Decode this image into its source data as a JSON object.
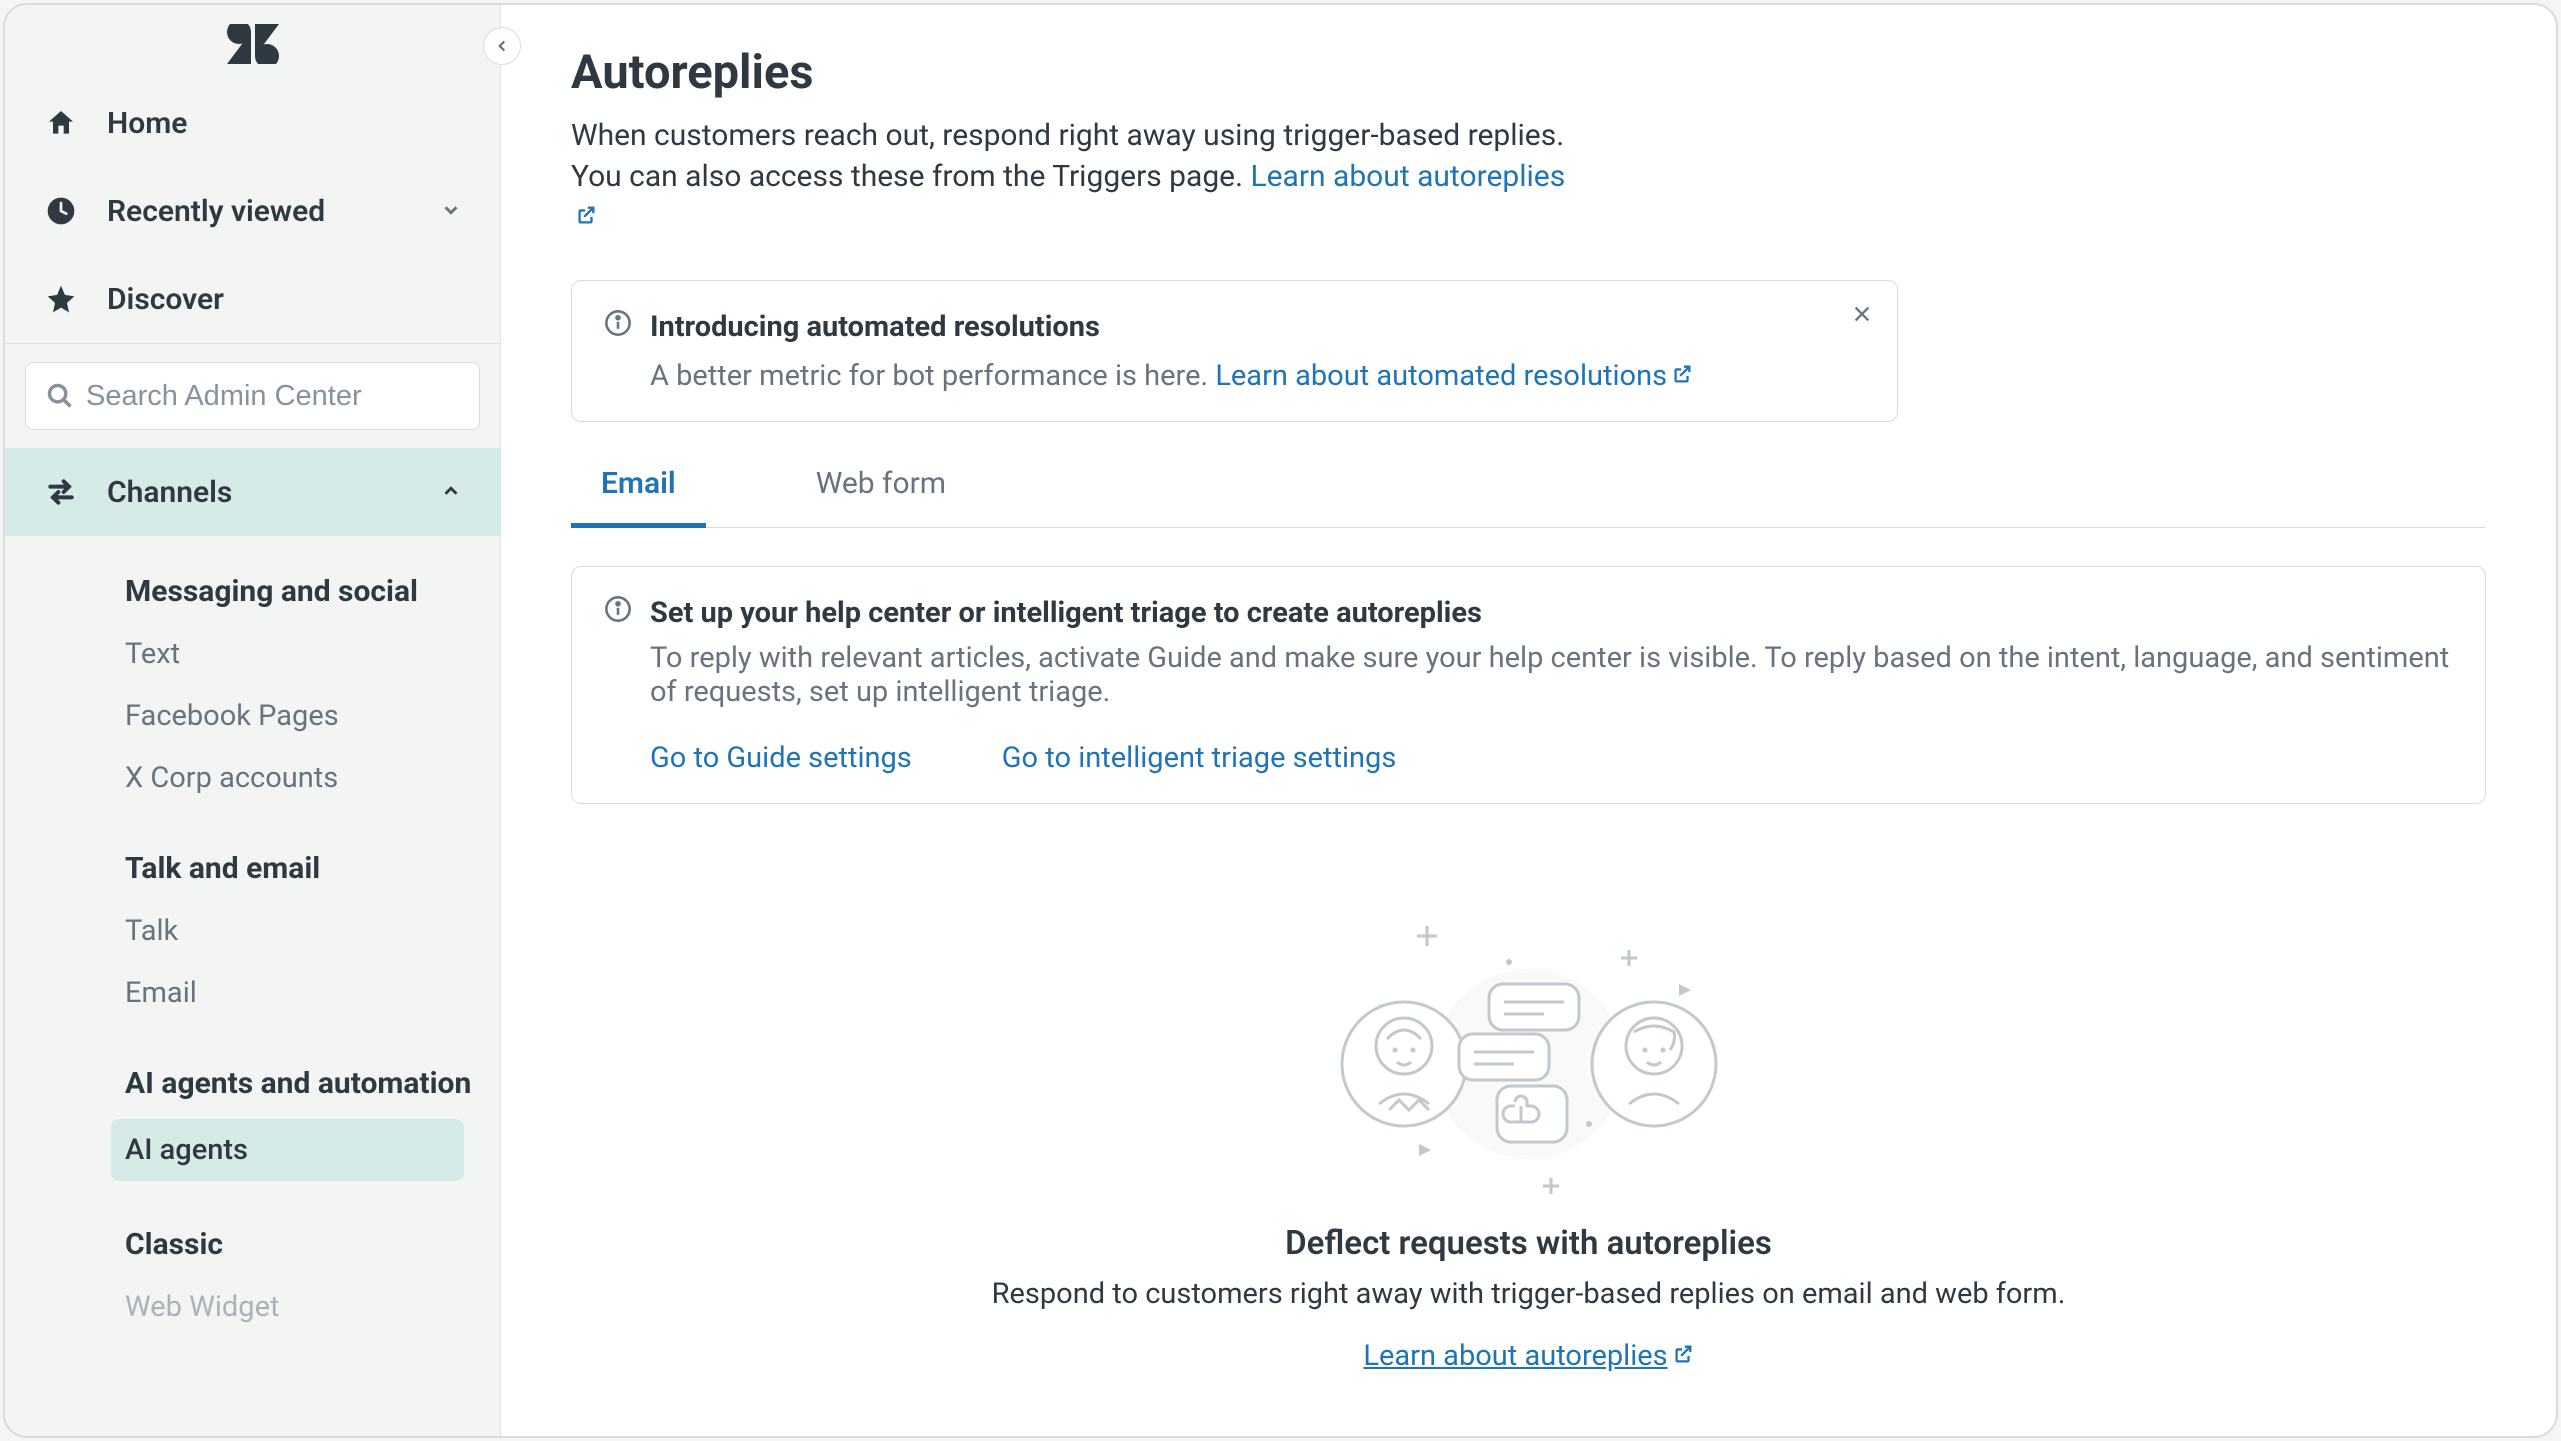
{
  "sidebar": {
    "nav": {
      "home": "Home",
      "recently_viewed": "Recently viewed",
      "discover": "Discover"
    },
    "search_placeholder": "Search Admin Center",
    "channels_label": "Channels",
    "groups": [
      {
        "title": "Messaging and social",
        "items": [
          "Text",
          "Facebook Pages",
          "X Corp accounts"
        ]
      },
      {
        "title": "Talk and email",
        "items": [
          "Talk",
          "Email"
        ]
      },
      {
        "title": "AI agents and automation",
        "items_active": [
          "AI agents"
        ]
      },
      {
        "title": "Classic",
        "items": [
          "Web Widget"
        ]
      }
    ]
  },
  "page": {
    "title": "Autoreplies",
    "desc_pre": "When customers reach out, respond right away using trigger-based replies. You can also access these from the Triggers page. ",
    "desc_link": "Learn about autoreplies"
  },
  "intro_callout": {
    "title": "Introducing automated resolutions",
    "body_pre": "A better metric for bot performance is here. ",
    "body_link": "Learn about automated resolutions"
  },
  "tabs": {
    "email": "Email",
    "webform": "Web form"
  },
  "setup_callout": {
    "title": "Set up your help center or intelligent triage to create autoreplies",
    "desc": "To reply with relevant articles, activate Guide and make sure your help center is visible. To reply based on the intent, language, and sentiment of requests, set up intelligent triage.",
    "link_guide": "Go to Guide settings",
    "link_triage": "Go to intelligent triage settings"
  },
  "empty": {
    "title": "Deflect requests with autoreplies",
    "desc": "Respond to customers right away with trigger-based replies on email and web form.",
    "link": "Learn about autoreplies"
  }
}
